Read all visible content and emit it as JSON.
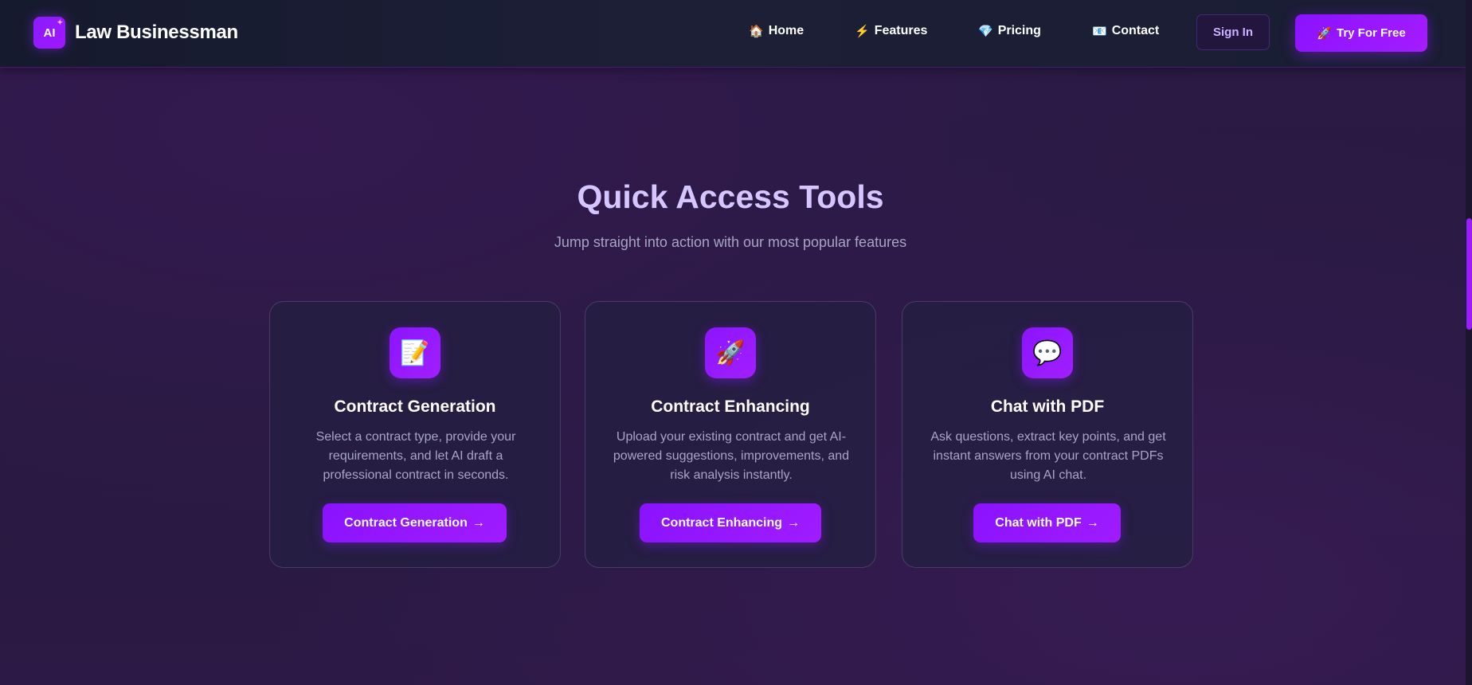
{
  "header": {
    "logo_text": "AI",
    "brand_name": "Law Businessman",
    "nav": [
      {
        "label": "Home",
        "icon": "🏠",
        "icon_name": "home-icon"
      },
      {
        "label": "Features",
        "icon": "⚡",
        "icon_name": "lightning-icon"
      },
      {
        "label": "Pricing",
        "icon": "💎",
        "icon_name": "gem-icon"
      },
      {
        "label": "Contact",
        "icon": "📧",
        "icon_name": "email-icon"
      }
    ],
    "sign_in_label": "Sign In",
    "try_free_label": "Try For Free",
    "try_free_icon": "🚀"
  },
  "main": {
    "title": "Quick Access Tools",
    "subtitle": "Jump straight into action with our most popular features",
    "cards": [
      {
        "icon": "📝",
        "icon_name": "memo-icon",
        "title": "Contract Generation",
        "description": "Select a contract type, provide your requirements, and let AI draft a professional contract in seconds.",
        "button_label": "Contract Generation",
        "button_arrow": "→"
      },
      {
        "icon": "🚀",
        "icon_name": "rocket-icon",
        "title": "Contract Enhancing",
        "description": "Upload your existing contract and get AI-powered suggestions, improvements, and risk analysis instantly.",
        "button_label": "Contract Enhancing",
        "button_arrow": "→"
      },
      {
        "icon": "💬",
        "icon_name": "speech-bubble-icon",
        "title": "Chat with PDF",
        "description": "Ask questions, extract key points, and get instant answers from your contract PDFs using AI chat.",
        "button_label": "Chat with PDF",
        "button_arrow": "→"
      }
    ]
  },
  "colors": {
    "accent": "#9b1cff",
    "title": "#d5c6ff",
    "text_muted": "#a8a6c4",
    "background": "#2b1a45",
    "navbar": "#1a1d33"
  }
}
